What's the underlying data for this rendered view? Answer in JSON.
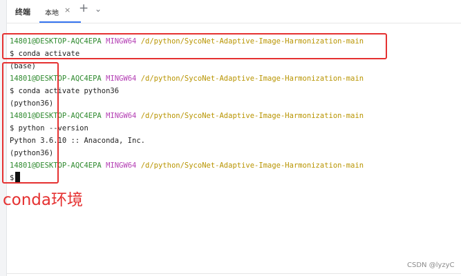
{
  "tabs": {
    "title": "终端",
    "active_label": "本地",
    "close_glyph": "×",
    "add_glyph": "+",
    "chevron_glyph": "⌄"
  },
  "terminal": {
    "lines": [
      {
        "type": "prompt",
        "user": "14801@DESKTOP-AQC4EPA",
        "sys": "MINGW64",
        "path": "/d/python/SycoNet-Adaptive-Image-Harmonization-main"
      },
      {
        "type": "cmd",
        "text": "$ conda activate"
      },
      {
        "type": "out",
        "text": "(base)"
      },
      {
        "type": "prompt",
        "user": "14801@DESKTOP-AQC4EPA",
        "sys": "MINGW64",
        "path": "/d/python/SycoNet-Adaptive-Image-Harmonization-main"
      },
      {
        "type": "cmd",
        "text": "$ conda activate python36"
      },
      {
        "type": "out",
        "text": "(python36)"
      },
      {
        "type": "prompt",
        "user": "14801@DESKTOP-AQC4EPA",
        "sys": "MINGW64",
        "path": "/d/python/SycoNet-Adaptive-Image-Harmonization-main"
      },
      {
        "type": "cmd",
        "text": "$ python --version"
      },
      {
        "type": "out",
        "text": "Python 3.6.10 :: Anaconda, Inc."
      },
      {
        "type": "out",
        "text": "(python36)"
      },
      {
        "type": "prompt",
        "user": "14801@DESKTOP-AQC4EPA",
        "sys": "MINGW64",
        "path": "/d/python/SycoNet-Adaptive-Image-Harmonization-main"
      },
      {
        "type": "cmd",
        "text": "$"
      }
    ]
  },
  "annotation": {
    "text": "conda环境",
    "color": "#e53030"
  },
  "watermark": {
    "text": "CSDN @lyzyC"
  },
  "colors": {
    "user": "#2f8a2f",
    "sys": "#b43fb4",
    "path": "#b89400",
    "accent": "#3574f0"
  }
}
